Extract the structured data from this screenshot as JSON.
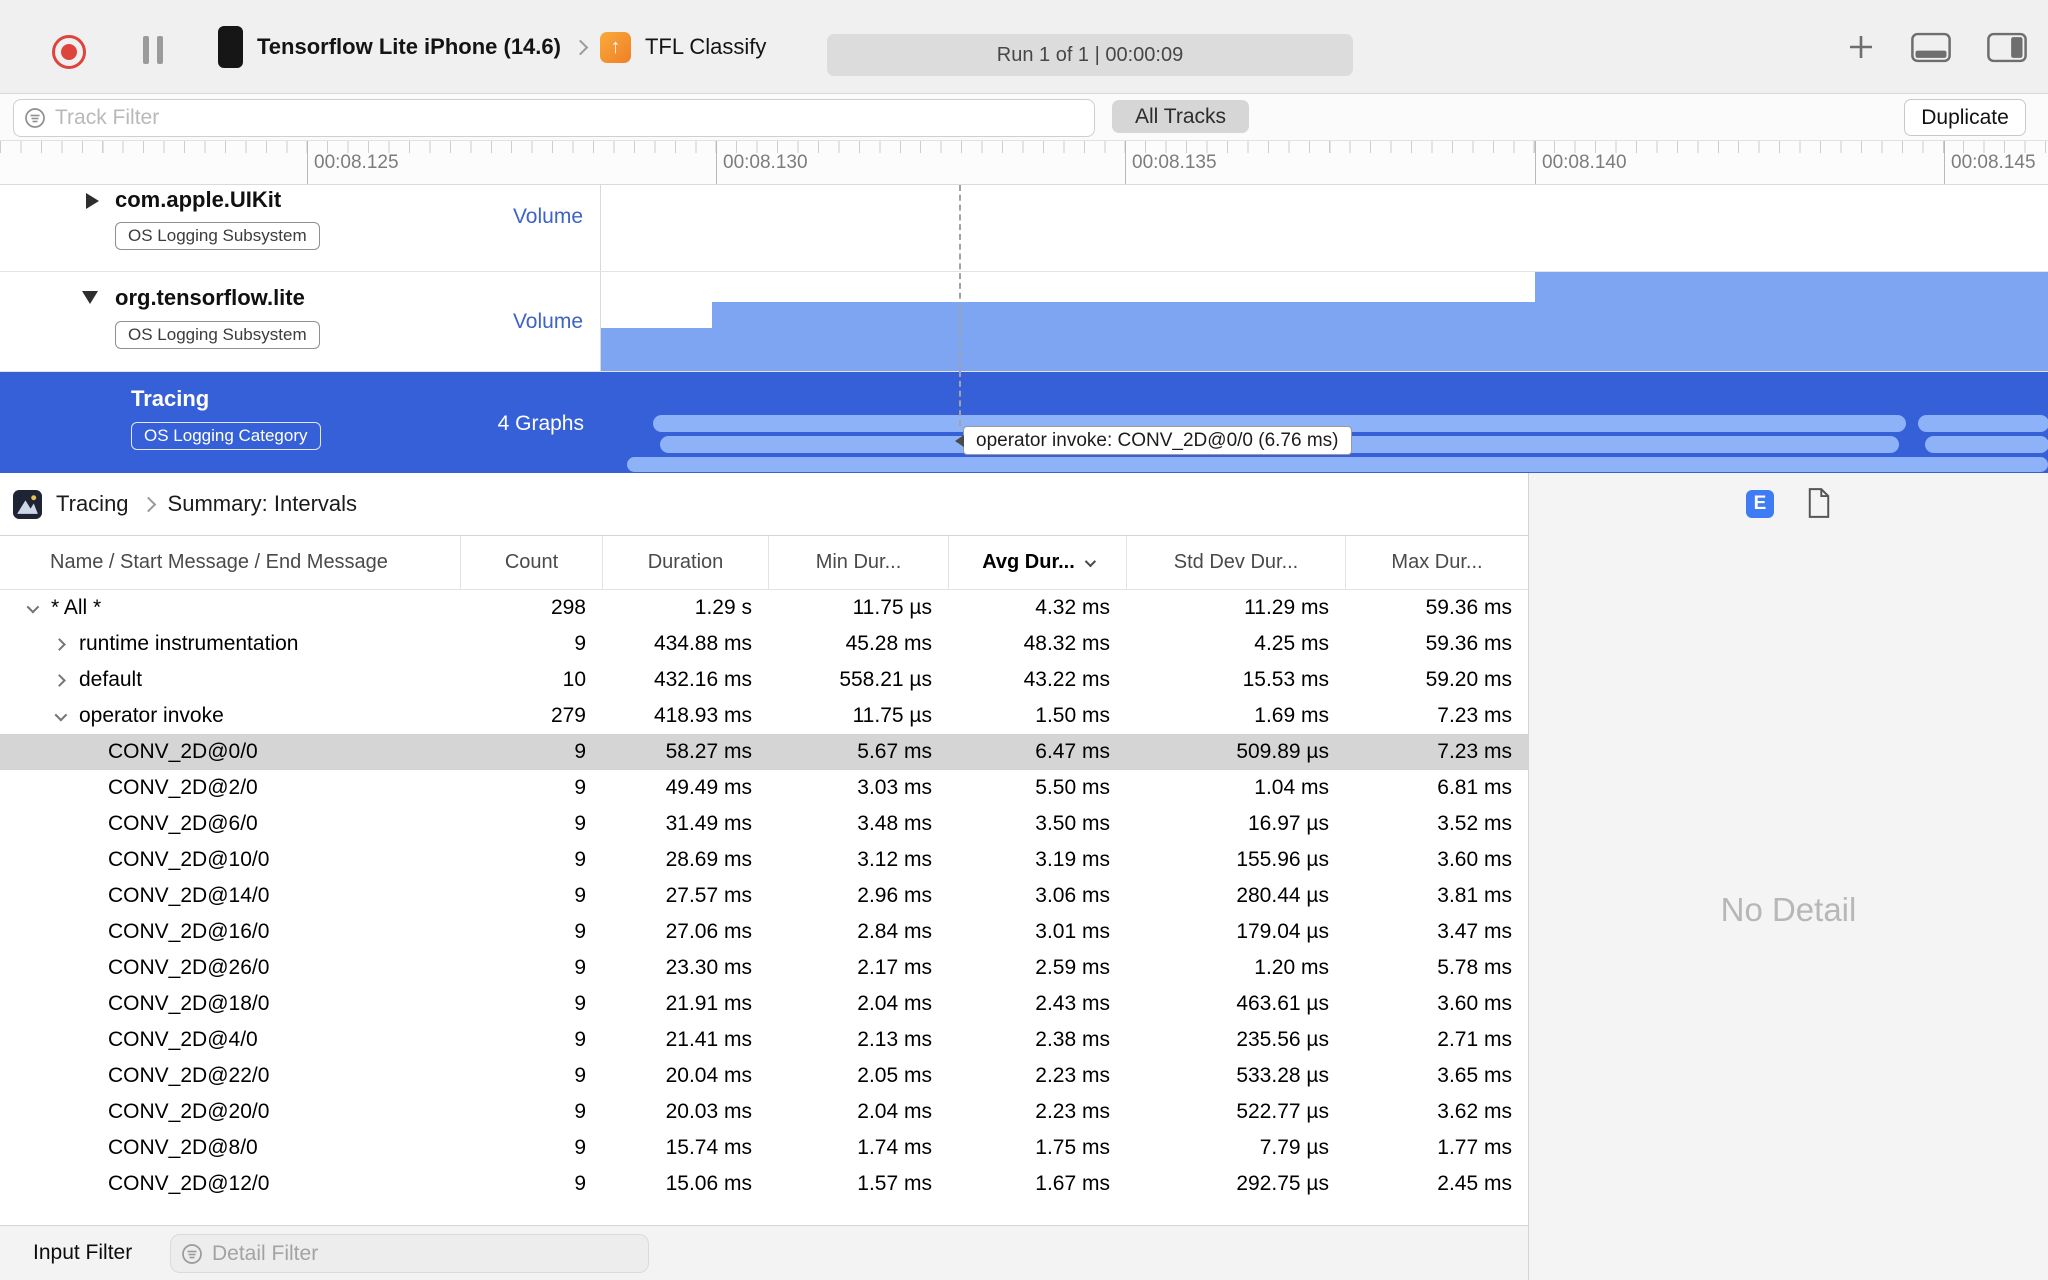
{
  "toolbar": {
    "device_label": "Tensorflow Lite iPhone (14.6)",
    "app_label": "TFL Classify",
    "run_status": "Run 1 of 1  |  00:00:09"
  },
  "filter_bar": {
    "track_filter_placeholder": "Track Filter",
    "all_tracks_label": "All Tracks",
    "duplicate_label": "Duplicate"
  },
  "ruler": {
    "labels": [
      "00:08.125",
      "00:08.130",
      "00:08.135",
      "00:08.140",
      "00:08.145"
    ]
  },
  "tracks": [
    {
      "name": "com.apple.UIKit",
      "badge": "OS Logging Subsystem",
      "meter": "Volume"
    },
    {
      "name": "org.tensorflow.lite",
      "badge": "OS Logging Subsystem",
      "meter": "Volume"
    },
    {
      "name": "Tracing",
      "badge": "OS Logging Category",
      "meter": "4 Graphs"
    }
  ],
  "timeline": {
    "tooltip": "operator invoke: CONV_2D@0/0 (6.76 ms)"
  },
  "detail": {
    "breadcrumb_root": "Tracing",
    "breadcrumb_current": "Summary: Intervals",
    "e_button": "E",
    "no_detail": "No Detail"
  },
  "table": {
    "headers": [
      {
        "label": "Name / Start Message / End Message"
      },
      {
        "label": "Count"
      },
      {
        "label": "Duration"
      },
      {
        "label": "Min Dur..."
      },
      {
        "label": "Avg Dur...",
        "sorted": true
      },
      {
        "label": "Std Dev Dur..."
      },
      {
        "label": "Max Dur..."
      }
    ],
    "rows": [
      {
        "level": 0,
        "expand": "down",
        "name": "* All *",
        "count": "298",
        "duration": "1.29 s",
        "min": "11.75 µs",
        "avg": "4.32 ms",
        "std": "11.29 ms",
        "max": "59.36 ms"
      },
      {
        "level": 1,
        "expand": "right",
        "name": "runtime instrumentation",
        "count": "9",
        "duration": "434.88 ms",
        "min": "45.28 ms",
        "avg": "48.32 ms",
        "std": "4.25 ms",
        "max": "59.36 ms"
      },
      {
        "level": 1,
        "expand": "right",
        "name": "default",
        "count": "10",
        "duration": "432.16 ms",
        "min": "558.21 µs",
        "avg": "43.22 ms",
        "std": "15.53 ms",
        "max": "59.20 ms"
      },
      {
        "level": 1,
        "expand": "down",
        "name": "operator invoke",
        "count": "279",
        "duration": "418.93 ms",
        "min": "11.75 µs",
        "avg": "1.50 ms",
        "std": "1.69 ms",
        "max": "7.23 ms"
      },
      {
        "level": 2,
        "expand": null,
        "selected": true,
        "name": "CONV_2D@0/0",
        "count": "9",
        "duration": "58.27 ms",
        "min": "5.67 ms",
        "avg": "6.47 ms",
        "std": "509.89 µs",
        "max": "7.23 ms"
      },
      {
        "level": 2,
        "expand": null,
        "name": "CONV_2D@2/0",
        "count": "9",
        "duration": "49.49 ms",
        "min": "3.03 ms",
        "avg": "5.50 ms",
        "std": "1.04 ms",
        "max": "6.81 ms"
      },
      {
        "level": 2,
        "expand": null,
        "name": "CONV_2D@6/0",
        "count": "9",
        "duration": "31.49 ms",
        "min": "3.48 ms",
        "avg": "3.50 ms",
        "std": "16.97 µs",
        "max": "3.52 ms"
      },
      {
        "level": 2,
        "expand": null,
        "name": "CONV_2D@10/0",
        "count": "9",
        "duration": "28.69 ms",
        "min": "3.12 ms",
        "avg": "3.19 ms",
        "std": "155.96 µs",
        "max": "3.60 ms"
      },
      {
        "level": 2,
        "expand": null,
        "name": "CONV_2D@14/0",
        "count": "9",
        "duration": "27.57 ms",
        "min": "2.96 ms",
        "avg": "3.06 ms",
        "std": "280.44 µs",
        "max": "3.81 ms"
      },
      {
        "level": 2,
        "expand": null,
        "name": "CONV_2D@16/0",
        "count": "9",
        "duration": "27.06 ms",
        "min": "2.84 ms",
        "avg": "3.01 ms",
        "std": "179.04 µs",
        "max": "3.47 ms"
      },
      {
        "level": 2,
        "expand": null,
        "name": "CONV_2D@26/0",
        "count": "9",
        "duration": "23.30 ms",
        "min": "2.17 ms",
        "avg": "2.59 ms",
        "std": "1.20 ms",
        "max": "5.78 ms"
      },
      {
        "level": 2,
        "expand": null,
        "name": "CONV_2D@18/0",
        "count": "9",
        "duration": "21.91 ms",
        "min": "2.04 ms",
        "avg": "2.43 ms",
        "std": "463.61 µs",
        "max": "3.60 ms"
      },
      {
        "level": 2,
        "expand": null,
        "name": "CONV_2D@4/0",
        "count": "9",
        "duration": "21.41 ms",
        "min": "2.13 ms",
        "avg": "2.38 ms",
        "std": "235.56 µs",
        "max": "2.71 ms"
      },
      {
        "level": 2,
        "expand": null,
        "name": "CONV_2D@22/0",
        "count": "9",
        "duration": "20.04 ms",
        "min": "2.05 ms",
        "avg": "2.23 ms",
        "std": "533.28 µs",
        "max": "3.65 ms"
      },
      {
        "level": 2,
        "expand": null,
        "name": "CONV_2D@20/0",
        "count": "9",
        "duration": "20.03 ms",
        "min": "2.04 ms",
        "avg": "2.23 ms",
        "std": "522.77 µs",
        "max": "3.62 ms"
      },
      {
        "level": 2,
        "expand": null,
        "name": "CONV_2D@8/0",
        "count": "9",
        "duration": "15.74 ms",
        "min": "1.74 ms",
        "avg": "1.75 ms",
        "std": "7.79 µs",
        "max": "1.77 ms"
      },
      {
        "level": 2,
        "expand": null,
        "name": "CONV_2D@12/0",
        "count": "9",
        "duration": "15.06 ms",
        "min": "1.57 ms",
        "avg": "1.67 ms",
        "std": "292.75 µs",
        "max": "2.45 ms"
      }
    ]
  },
  "bottom_bar": {
    "input_filter_label": "Input Filter",
    "detail_filter_placeholder": "Detail Filter"
  }
}
